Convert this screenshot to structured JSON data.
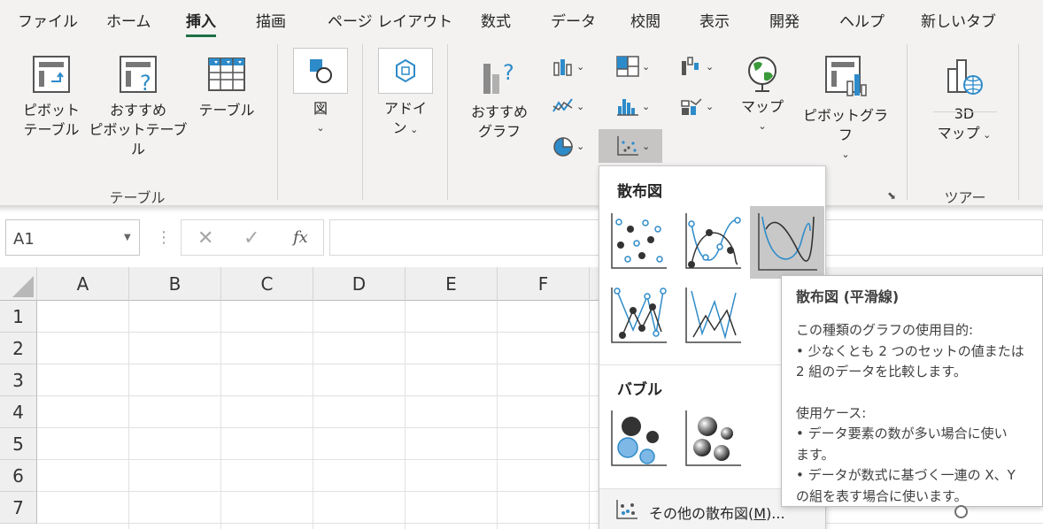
{
  "tabs": [
    "ファイル",
    "ホーム",
    "挿入",
    "描画",
    "ページ レイアウト",
    "数式",
    "データ",
    "校閲",
    "表示",
    "開発",
    "ヘルプ",
    "新しいタブ"
  ],
  "ribbon": {
    "pivot_table": [
      "ピボット",
      "テーブル"
    ],
    "recommended_pivot": [
      "おすすめ",
      "ピボットテーブル"
    ],
    "table": "テーブル",
    "group_tables": "テーブル",
    "illustrations": "図",
    "addins": [
      "アドイ",
      "ン"
    ],
    "recommended_charts": [
      "おすすめ",
      "グラフ"
    ],
    "maps": "マップ",
    "pivot_chart": "ピボットグラフ",
    "map3d": [
      "3D",
      "マップ"
    ],
    "group_tours": "ツアー"
  },
  "formula_bar": {
    "name_box": "A1",
    "fx": "fx"
  },
  "grid": {
    "columns": [
      "A",
      "B",
      "C",
      "D",
      "E",
      "F"
    ],
    "rows": [
      "1",
      "2",
      "3",
      "4",
      "5",
      "6",
      "7"
    ]
  },
  "gallery": {
    "section_scatter": "散布図",
    "section_bubble": "バブル",
    "more": "その他の散布図(M)...",
    "more_access_key": "M"
  },
  "tooltip": {
    "title": "散布図 (平滑線)",
    "lines": [
      "この種類のグラフの使用目的:",
      "• 少なくとも 2 つのセットの値または",
      "2 組のデータを比較します。",
      "",
      "使用ケース:",
      "• データ要素の数が多い場合に使い",
      "ます。",
      "• データが数式に基づく一連の X、Y",
      "の組を表す場合に使います。"
    ]
  },
  "colors": {
    "accent_green": "#1e7145",
    "chart_blue": "#2e8bc9",
    "ribbon_bg": "#f3f2f1"
  }
}
